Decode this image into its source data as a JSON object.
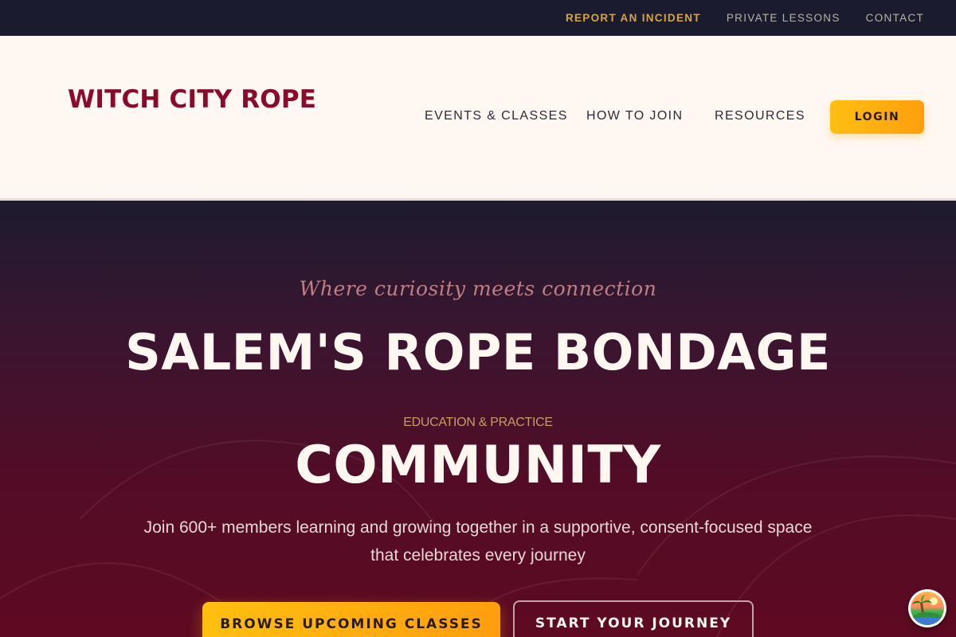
{
  "utility_nav": {
    "report_incident": "REPORT AN INCIDENT",
    "private_lessons": "PRIVATE LESSONS",
    "contact": "CONTACT"
  },
  "header": {
    "logo": "WITCH CITY ROPE",
    "nav": {
      "events": "EVENTS & CLASSES",
      "how_to_join": "HOW TO JOIN",
      "resources": "RESOURCES"
    },
    "login_label": "LOGIN"
  },
  "hero": {
    "tagline": "Where curiosity meets connection",
    "headline_1": "SALEM'S ROPE BONDAGE",
    "eyebrow": "EDUCATION & PRACTICE",
    "headline_2": "COMMUNITY",
    "description": "Join 600+ members learning and growing together in a supportive, consent-focused space that celebrates every journey",
    "cta_primary": "BROWSE UPCOMING CLASSES",
    "cta_secondary": "START YOUR JOURNEY"
  },
  "colors": {
    "brand": "#8b0a2a",
    "accent": "#ffb20f",
    "dark": "#1a1b2e"
  },
  "floating_badge": {
    "icon": "island-avatar-icon"
  }
}
